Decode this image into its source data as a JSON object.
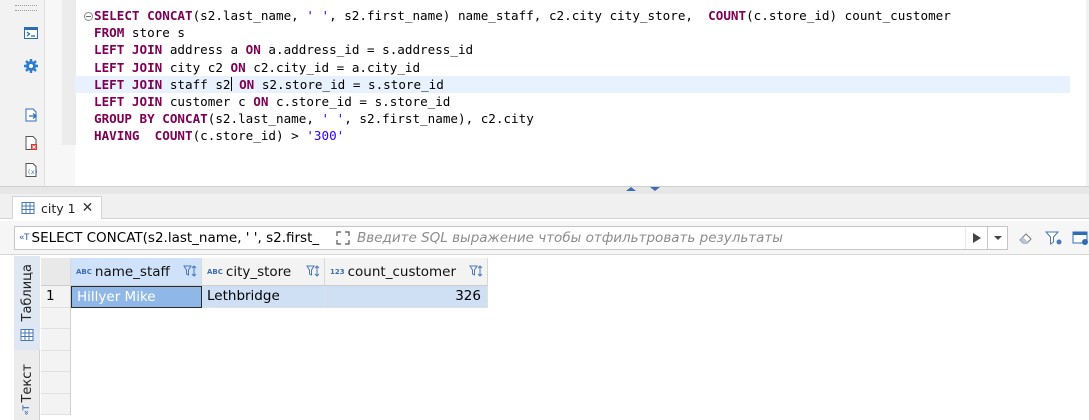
{
  "editor": {
    "lines": [
      [
        {
          "k": "kw",
          "t": "SELECT "
        },
        {
          "k": "kw",
          "t": "CONCAT"
        },
        {
          "k": "",
          "t": "(s2.last_name, "
        },
        {
          "k": "str",
          "t": "' '"
        },
        {
          "k": "",
          "t": ", s2.first_name) name_staff, c2.city city_store,  "
        },
        {
          "k": "kw",
          "t": "COUNT"
        },
        {
          "k": "",
          "t": "(c.store_id) count_customer"
        }
      ],
      [
        {
          "k": "kw",
          "t": "FROM"
        },
        {
          "k": "",
          "t": " store s"
        }
      ],
      [
        {
          "k": "kw",
          "t": "LEFT JOIN"
        },
        {
          "k": "",
          "t": " address a "
        },
        {
          "k": "kw",
          "t": "ON"
        },
        {
          "k": "",
          "t": " a.address_id = s.address_id"
        }
      ],
      [
        {
          "k": "kw",
          "t": "LEFT JOIN"
        },
        {
          "k": "",
          "t": " city c2 "
        },
        {
          "k": "kw",
          "t": "ON"
        },
        {
          "k": "",
          "t": " c2.city_id = a.city_id"
        }
      ],
      [
        {
          "k": "kw",
          "t": "LEFT JOIN"
        },
        {
          "k": "",
          "t": " staff s2"
        },
        {
          "k": "cursor",
          "t": ""
        },
        {
          "k": "",
          "t": " "
        },
        {
          "k": "kw",
          "t": "ON"
        },
        {
          "k": "",
          "t": " s2.store_id = s.store_id"
        }
      ],
      [
        {
          "k": "kw",
          "t": "LEFT JOIN"
        },
        {
          "k": "",
          "t": " customer c "
        },
        {
          "k": "kw",
          "t": "ON"
        },
        {
          "k": "",
          "t": " c.store_id = s.store_id"
        }
      ],
      [
        {
          "k": "kw",
          "t": "GROUP BY"
        },
        {
          "k": "",
          "t": " "
        },
        {
          "k": "kw",
          "t": "CONCAT"
        },
        {
          "k": "",
          "t": "(s2.last_name, "
        },
        {
          "k": "str",
          "t": "' '"
        },
        {
          "k": "",
          "t": ", s2.first_name), c2.city"
        }
      ],
      [
        {
          "k": "kw",
          "t": "HAVING"
        },
        {
          "k": "",
          "t": "  "
        },
        {
          "k": "kw",
          "t": "COUNT"
        },
        {
          "k": "",
          "t": "(c.store_id) > "
        },
        {
          "k": "str",
          "t": "'300'"
        }
      ]
    ],
    "current_line_index": 4
  },
  "results": {
    "tab_label": "city 1",
    "filter_sql": "SELECT CONCAT(s2.last_name, ' ', s2.first_",
    "filter_placeholder": "Введите SQL выражение чтобы отфильтровать результаты",
    "side_tabs": {
      "table": "Таблица",
      "text": "Текст"
    },
    "columns": [
      {
        "type_badge": "ABC",
        "name": "name_staff"
      },
      {
        "type_badge": "ABC",
        "name": "city_store"
      },
      {
        "type_badge": "123",
        "name": "count_customer"
      }
    ],
    "rows": [
      {
        "row_number": "1",
        "name_staff": "Hillyer Mike",
        "city_store": "Lethbridge",
        "count_customer": "326"
      }
    ]
  },
  "colors": {
    "keyword": "#800055",
    "string": "#2a00ff",
    "selection": "#cfe0f5",
    "focus_cell": "#8fb8e8"
  },
  "icons": [
    "console-icon",
    "settings-gear-icon",
    "export-icon",
    "file-icon",
    "variables-icon",
    "grid-table-icon",
    "text-view-icon",
    "expand-icon",
    "run-filter-icon",
    "dropdown-icon",
    "eraser-icon",
    "filter-settings-icon",
    "panel-icon"
  ]
}
